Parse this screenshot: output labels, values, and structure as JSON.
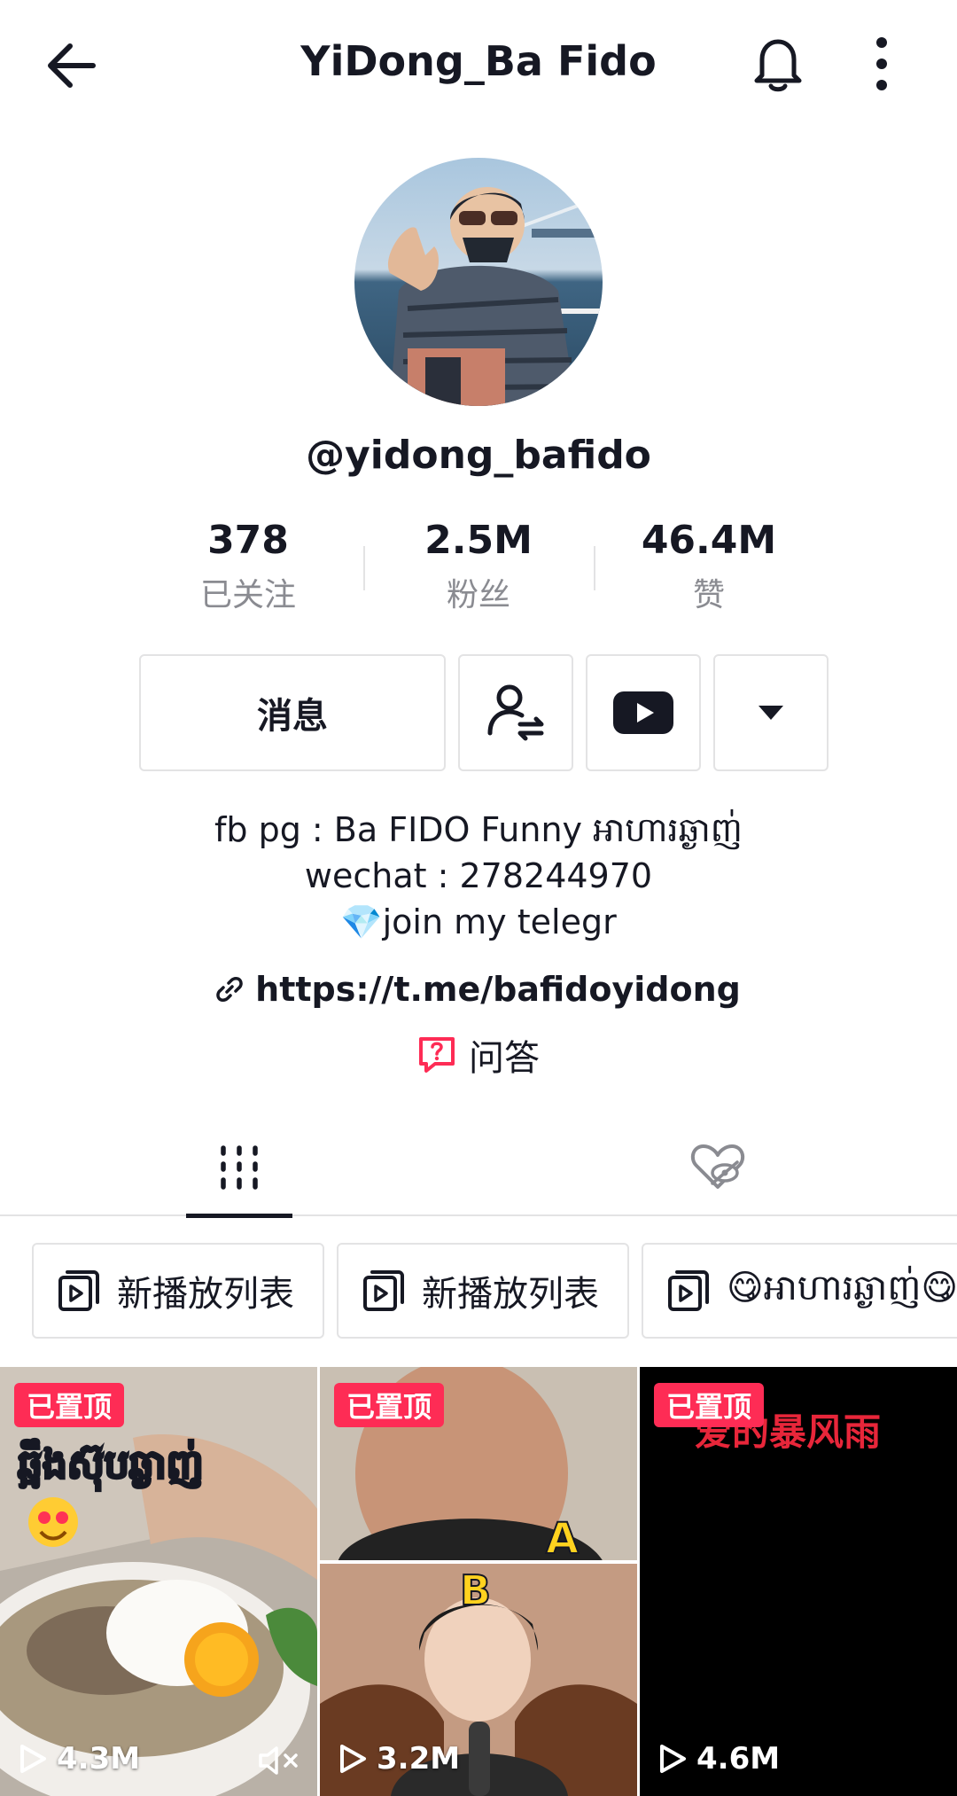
{
  "header": {
    "title": "YiDong_Ba Fido",
    "back_icon": "arrow-left-icon",
    "bell_icon": "bell-icon",
    "more_icon": "more-vertical-icon"
  },
  "profile": {
    "username": "@yidong_bafido",
    "stats": [
      {
        "value": "378",
        "label": "已关注"
      },
      {
        "value": "2.5M",
        "label": "粉丝"
      },
      {
        "value": "46.4M",
        "label": "赞"
      }
    ]
  },
  "actions": {
    "message_label": "消息",
    "friends_icon": "user-switch-icon",
    "youtube_icon": "youtube-icon",
    "dropdown_icon": "caret-down-icon"
  },
  "bio": {
    "line1": "fb pg : Ba FIDO Funny អាហារឆ្ងាញ់",
    "line2": "wechat : 278244970",
    "line3_emoji": "💎",
    "line3": "join my telegr"
  },
  "link": {
    "icon": "link-icon",
    "url": "https://t.me/bafidoyidong"
  },
  "qa": {
    "icon": "question-bubble-icon",
    "label": "问答"
  },
  "tabs": [
    {
      "icon": "grid-icon",
      "active": true
    },
    {
      "icon": "hidden-heart-icon",
      "active": false
    }
  ],
  "playlists": [
    {
      "label": "新播放列表"
    },
    {
      "label": "新播放列表"
    },
    {
      "label": "😋អាហារឆ្ងាញ់😋"
    }
  ],
  "videos": [
    {
      "badge": "已置顶",
      "views": "4.3M",
      "overlay_text": "ឆ្អឹងស៊ុបឆ្ងាញ់",
      "muted": true
    },
    {
      "badge": "已置顶",
      "views": "3.2M",
      "overlay_a": "A",
      "overlay_b": "B",
      "muted": false
    },
    {
      "badge": "已置顶",
      "views": "4.6M",
      "overlay_text": "爱的暴风雨",
      "muted": false
    }
  ],
  "colors": {
    "accent": "#fe2c55",
    "text": "#161823",
    "secondary": "#8a8b91",
    "border": "#e3e3e4"
  }
}
